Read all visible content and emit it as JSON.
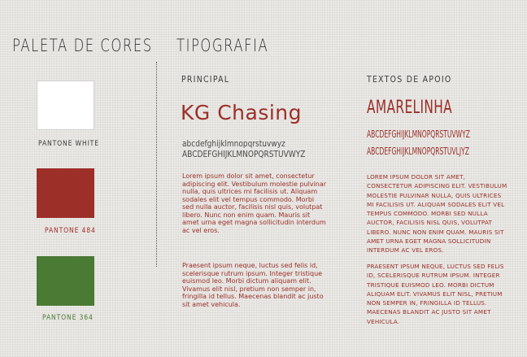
{
  "palette": {
    "title": "PALETA DE CORES",
    "swatches": [
      {
        "label": "PANTONE WHITE",
        "color": "#ffffff",
        "label_color": "#3a3a3a"
      },
      {
        "label": "PANTONE 484",
        "color": "#9d2f29",
        "label_color": "#9d2f29"
      },
      {
        "label": "PANTONE 364",
        "color": "#4a7a34",
        "label_color": "#4a7a34"
      }
    ]
  },
  "typography": {
    "title": "TIPOGRAFIA",
    "primary": {
      "label": "PRINCIPAL",
      "font_name": "KG Chasing",
      "lowercase": "abcdefghijklmnopqrstuvwyz",
      "uppercase": "ABCDEFGHIJKLMNOPQRSTUVWYZ",
      "paragraph1": "Lorem ipsum dolor sit amet, consectetur adipiscing elit. Vestibulum molestie pulvinar nulla, quis ultrices mi facilisis ut. Aliquam sodales elit vel tempus commodo. Morbi sed nulla auctor, facilisis nisl quis, volutpat libero. Nunc non enim quam. Mauris sit amet urna eget magna sollicitudin interdum ac vel eros.",
      "paragraph2": "Praesent ipsum neque, luctus sed felis id, scelerisque rutrum ipsum. Integer tristique euismod leo. Morbi dictum aliquam elit. Vivamus elit nisl, pretium non semper in, fringilla id tellus. Maecenas blandit ac justo sit amet vehicula."
    },
    "support": {
      "label": "TEXTOS DE APOIO",
      "font_name": "AMARELINHA",
      "line1": "ABCDEFGHIJKLMNOPQRSTUVWYZ",
      "line2": "ABCDEFGHIJKLMNOPQRSTUVLJYZ",
      "paragraph1": "Lorem ipsum dolor sit amet, consectetur adipiscing elit. Vestibulum molestie pulvinar nulla, quis ultrices mi facilisis ut. Aliquam sodales elit vel tempus commodo. Morbi sed nulla auctor, facilisis nisl quis, volutpat libero. Nunc non enim quam. Mauris sit amet urna eget magna sollicitudin interdum ac vel eros.",
      "paragraph2": "Praesent ipsum neque, luctus sed felis id, scelerisque rutrum ipsum. Integer tristique euismod leo. Morbi dictum aliquam elit. Vivamus elit nisl, pretium non semper in, fringilla id tellus. Maecenas blandit ac justo sit amet vehicula."
    }
  }
}
